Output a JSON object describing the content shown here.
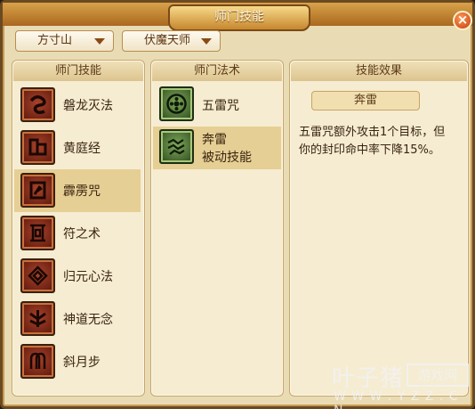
{
  "window": {
    "title": "师门技能",
    "close_icon": "close-icon"
  },
  "filters": {
    "school": "方寸山",
    "master": "伏魔天师"
  },
  "skills_panel": {
    "header": "师门技能",
    "items": [
      {
        "label": "磐龙灭法",
        "icon": "dragon-icon"
      },
      {
        "label": "黄庭经",
        "icon": "scroll-icon"
      },
      {
        "label": "霹雳咒",
        "icon": "lightning-icon",
        "selected": true
      },
      {
        "label": "符之术",
        "icon": "talisman-icon"
      },
      {
        "label": "归元心法",
        "icon": "heart-icon"
      },
      {
        "label": "神道无念",
        "icon": "spirit-icon"
      },
      {
        "label": "斜月步",
        "icon": "moon-step-icon"
      }
    ]
  },
  "spells_panel": {
    "header": "师门法术",
    "items": [
      {
        "label": "五雷咒",
        "sublabel": "",
        "icon": "thunder-seal-icon"
      },
      {
        "label": "奔雷",
        "sublabel": "被动技能",
        "icon": "storm-icon",
        "selected": true
      }
    ]
  },
  "effect_panel": {
    "header": "技能效果",
    "skill_name": "奔雷",
    "description_line1": "五雷咒额外攻击1个目标，但",
    "description_line2": "你的封印命中率下降15%。"
  },
  "watermark": {
    "main": "叶子猪",
    "box": "游戏网",
    "url": "W W W . Y Z Z . C N"
  }
}
